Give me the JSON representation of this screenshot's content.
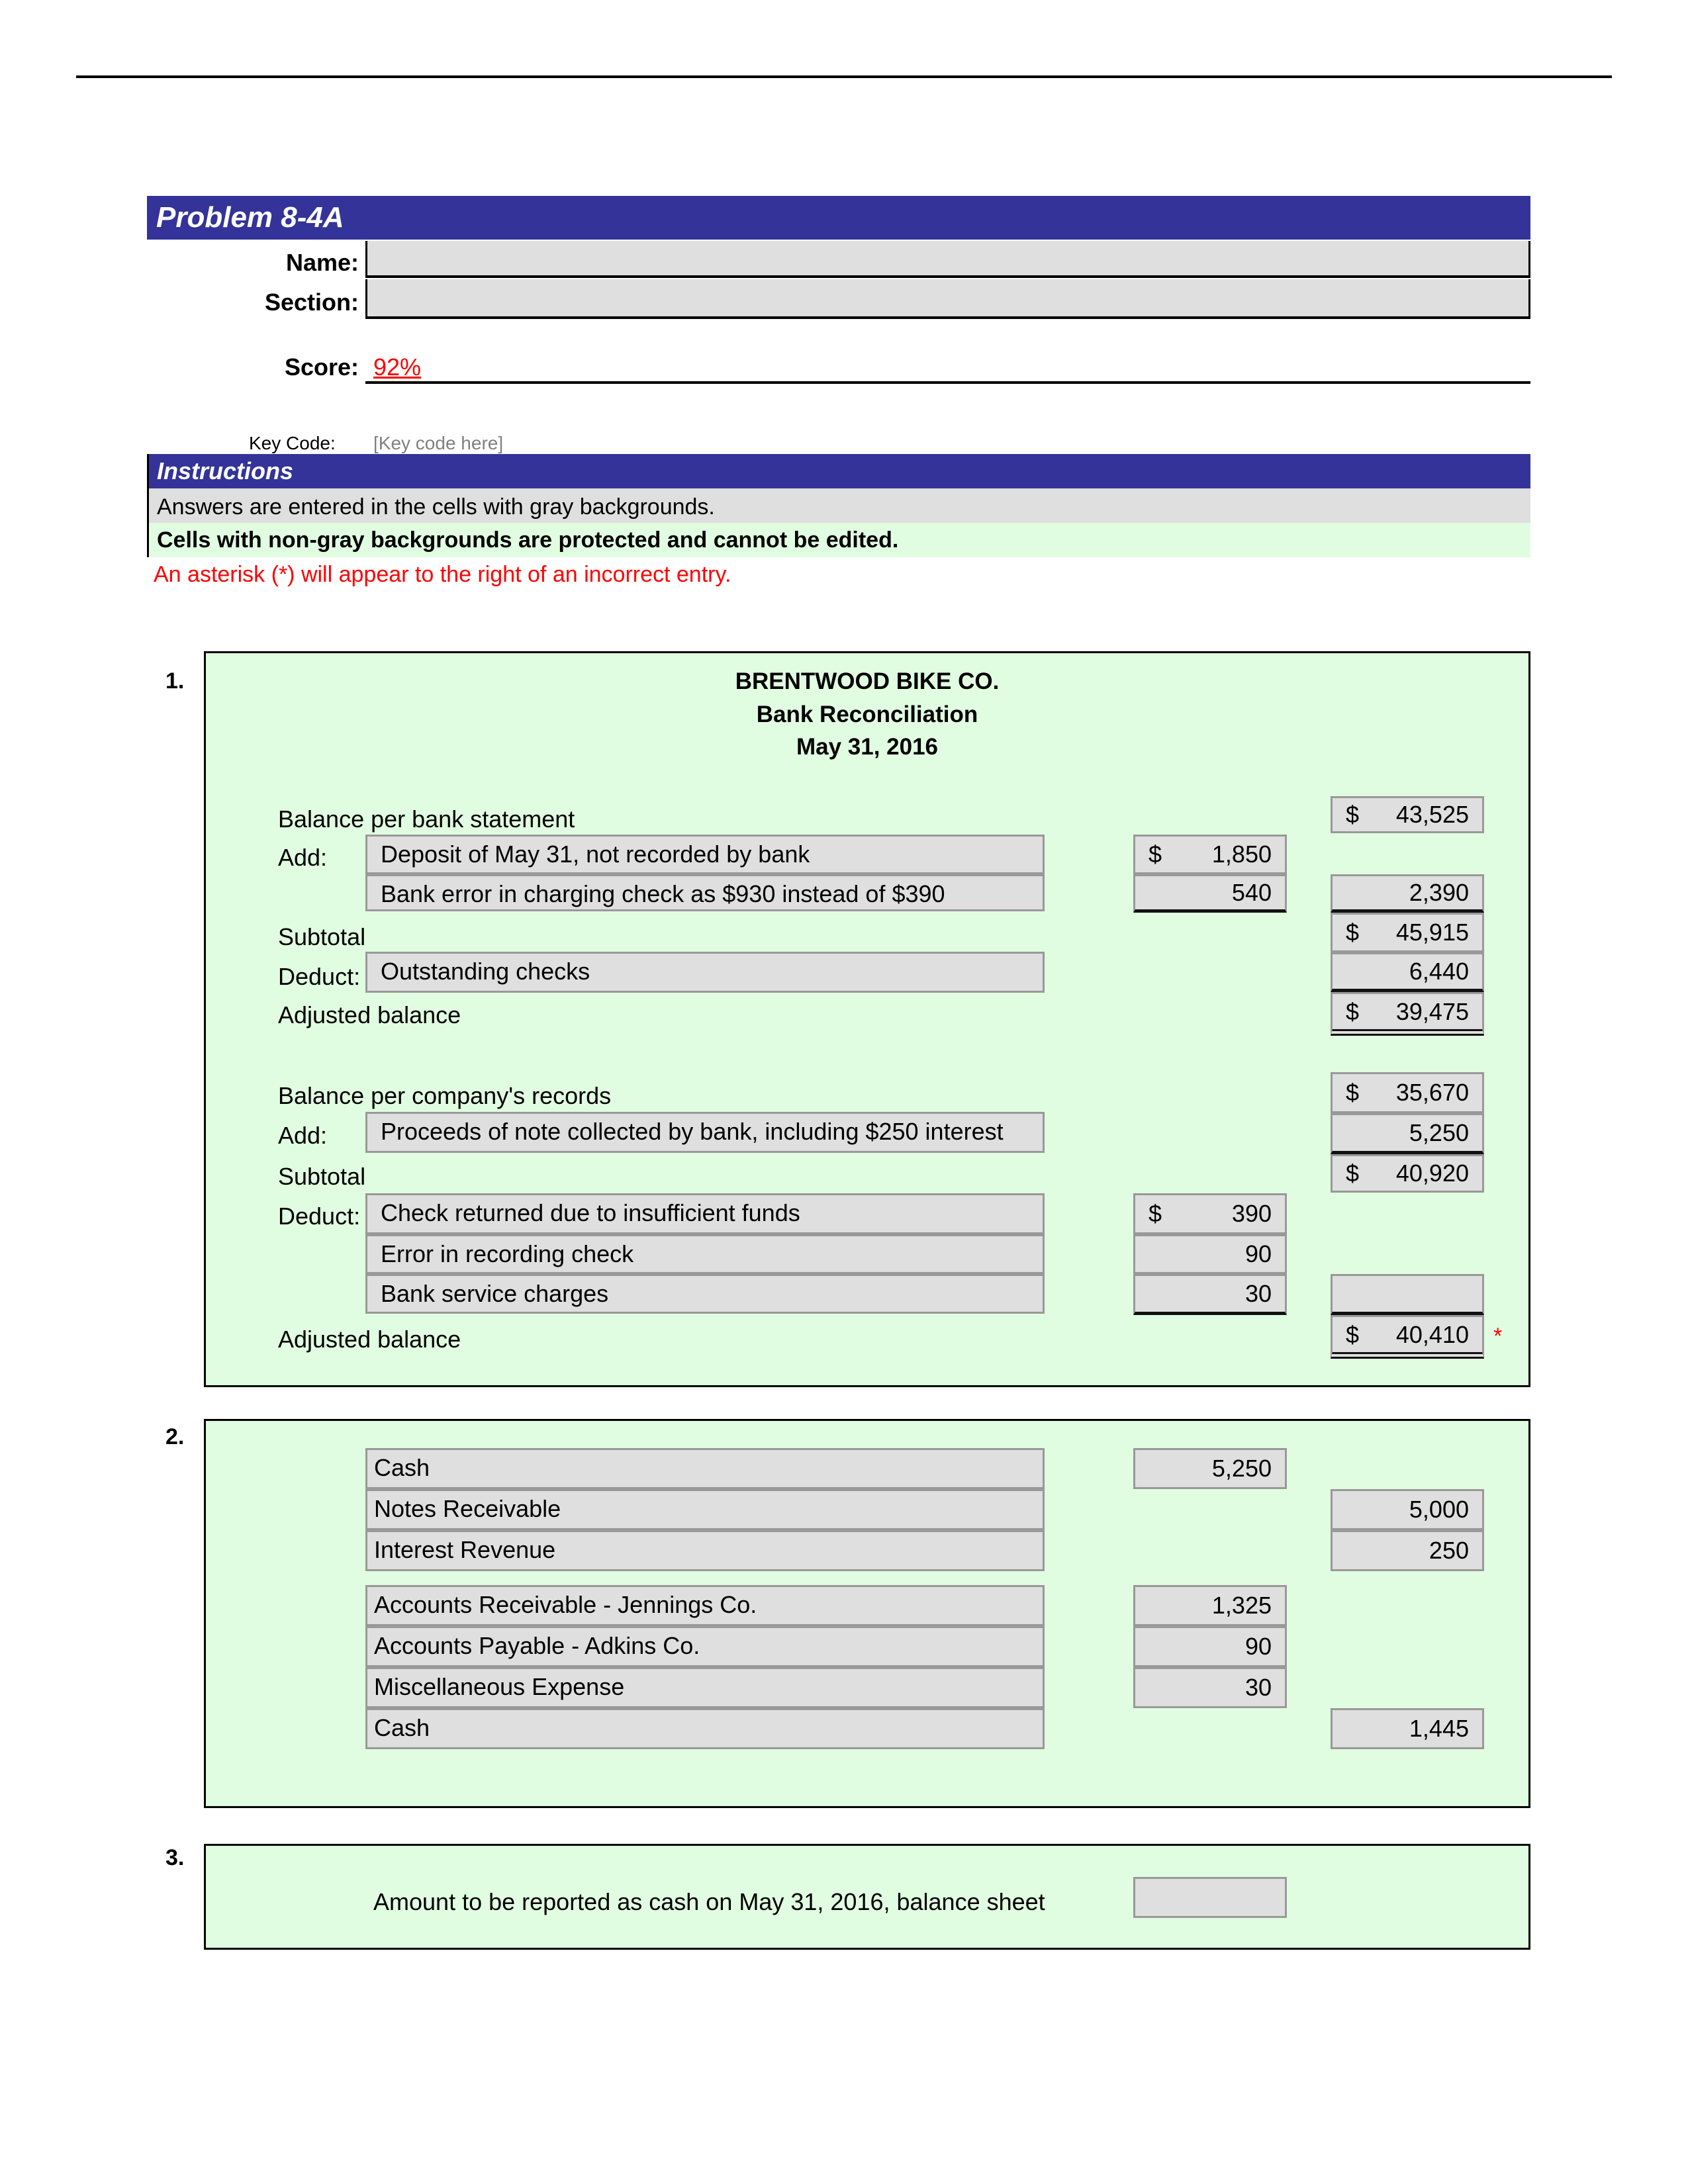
{
  "header": {
    "title": "Problem 8-4A",
    "name_label": "Name:",
    "name_value": "",
    "section_label": "Section:",
    "section_value": "",
    "score_label": "Score:",
    "score_value": "92%",
    "keycode_label": "Key Code:",
    "keycode_placeholder": "[Key code here]"
  },
  "instructions": {
    "title": "Instructions",
    "line1": "Answers are entered in the cells with gray backgrounds.",
    "line2": "Cells with non-gray backgrounds are protected and cannot be edited.",
    "line3": "An asterisk (*) will appear to the right of an incorrect entry."
  },
  "colors": {
    "header_bar": "#333399",
    "input_gray": "#dfdfdf",
    "protected_green": "#e1fde1",
    "error_red": "#ff0000"
  },
  "part1": {
    "number": "1.",
    "company": "BRENTWOOD BIKE CO.",
    "statement": "Bank Reconciliation",
    "date": "May 31, 2016",
    "bank": {
      "balance_label": "Balance per bank statement",
      "balance": {
        "dollar": "$",
        "value": "43,525"
      },
      "add_label": "Add:",
      "add_items": [
        {
          "desc": "Deposit of May 31, not recorded by bank",
          "dollar": "$",
          "amount": "1,850"
        },
        {
          "desc": "Bank error in charging check as $930 instead of $390",
          "dollar": "",
          "amount": "540"
        }
      ],
      "add_total": "2,390",
      "subtotal_label": "Subtotal",
      "subtotal": {
        "dollar": "$",
        "value": "45,915"
      },
      "deduct_label": "Deduct:",
      "deduct_items": [
        {
          "desc": "Outstanding checks",
          "amount": "6,440"
        }
      ],
      "adjusted_label": "Adjusted balance",
      "adjusted": {
        "dollar": "$",
        "value": "39,475"
      }
    },
    "company_books": {
      "balance_label": "Balance per company's records",
      "balance": {
        "dollar": "$",
        "value": "35,670"
      },
      "add_label": "Add:",
      "add_items": [
        {
          "desc": "Proceeds of note collected by bank, including $250 interest",
          "amount": "5,250"
        }
      ],
      "subtotal_label": "Subtotal",
      "subtotal": {
        "dollar": "$",
        "value": "40,920"
      },
      "deduct_label": "Deduct:",
      "deduct_items": [
        {
          "desc": "Check returned due to insufficient funds",
          "dollar": "$",
          "amount": "390"
        },
        {
          "desc": "Error in recording check",
          "dollar": "",
          "amount": "90"
        },
        {
          "desc": "Bank service charges",
          "dollar": "",
          "amount": "30"
        }
      ],
      "deduct_total": "",
      "adjusted_label": "Adjusted balance",
      "adjusted": {
        "dollar": "$",
        "value": "40,410"
      },
      "adjusted_error_mark": "*"
    }
  },
  "part2": {
    "number": "2.",
    "entry1": [
      {
        "account": "Cash",
        "debit": "5,250",
        "credit": ""
      },
      {
        "account": "Notes Receivable",
        "debit": "",
        "credit": "5,000"
      },
      {
        "account": "Interest Revenue",
        "debit": "",
        "credit": "250"
      }
    ],
    "entry2": [
      {
        "account": "Accounts Receivable - Jennings Co.",
        "debit": "1,325",
        "credit": ""
      },
      {
        "account": "Accounts Payable - Adkins Co.",
        "debit": "90",
        "credit": ""
      },
      {
        "account": "Miscellaneous Expense",
        "debit": "30",
        "credit": ""
      },
      {
        "account": "Cash",
        "debit": "",
        "credit": "1,445"
      }
    ]
  },
  "part3": {
    "number": "3.",
    "label": "Amount to be reported as cash on May 31, 2016, balance sheet",
    "value": ""
  }
}
